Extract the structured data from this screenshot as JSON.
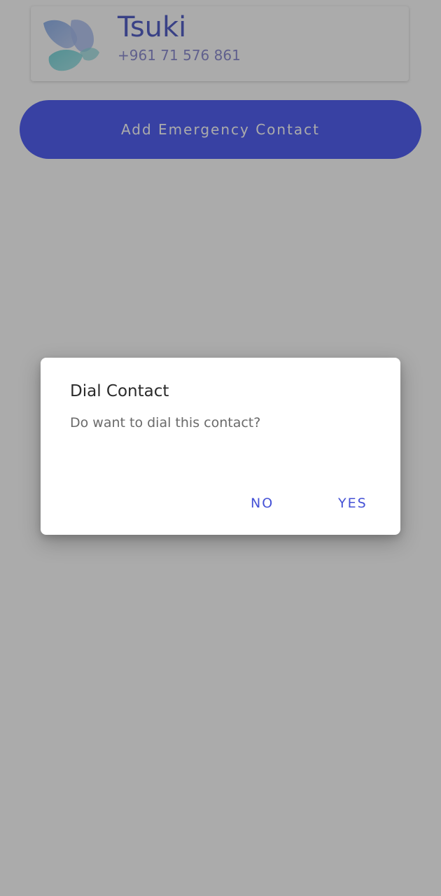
{
  "contact": {
    "name": "Tsuki",
    "phone": "+961 71 576 861",
    "avatar_icon": "butterfly-icon"
  },
  "add_button": {
    "label": "Add Emergency Contact"
  },
  "dialog": {
    "title": "Dial Contact",
    "message": "Do want to dial this contact?",
    "no_label": "NO",
    "yes_label": "YES"
  },
  "colors": {
    "accent": "#5461f3",
    "name_text": "#5561c8",
    "dialog_button_text": "#4552d6",
    "scrim": "rgba(0,0,0,0.33)"
  }
}
